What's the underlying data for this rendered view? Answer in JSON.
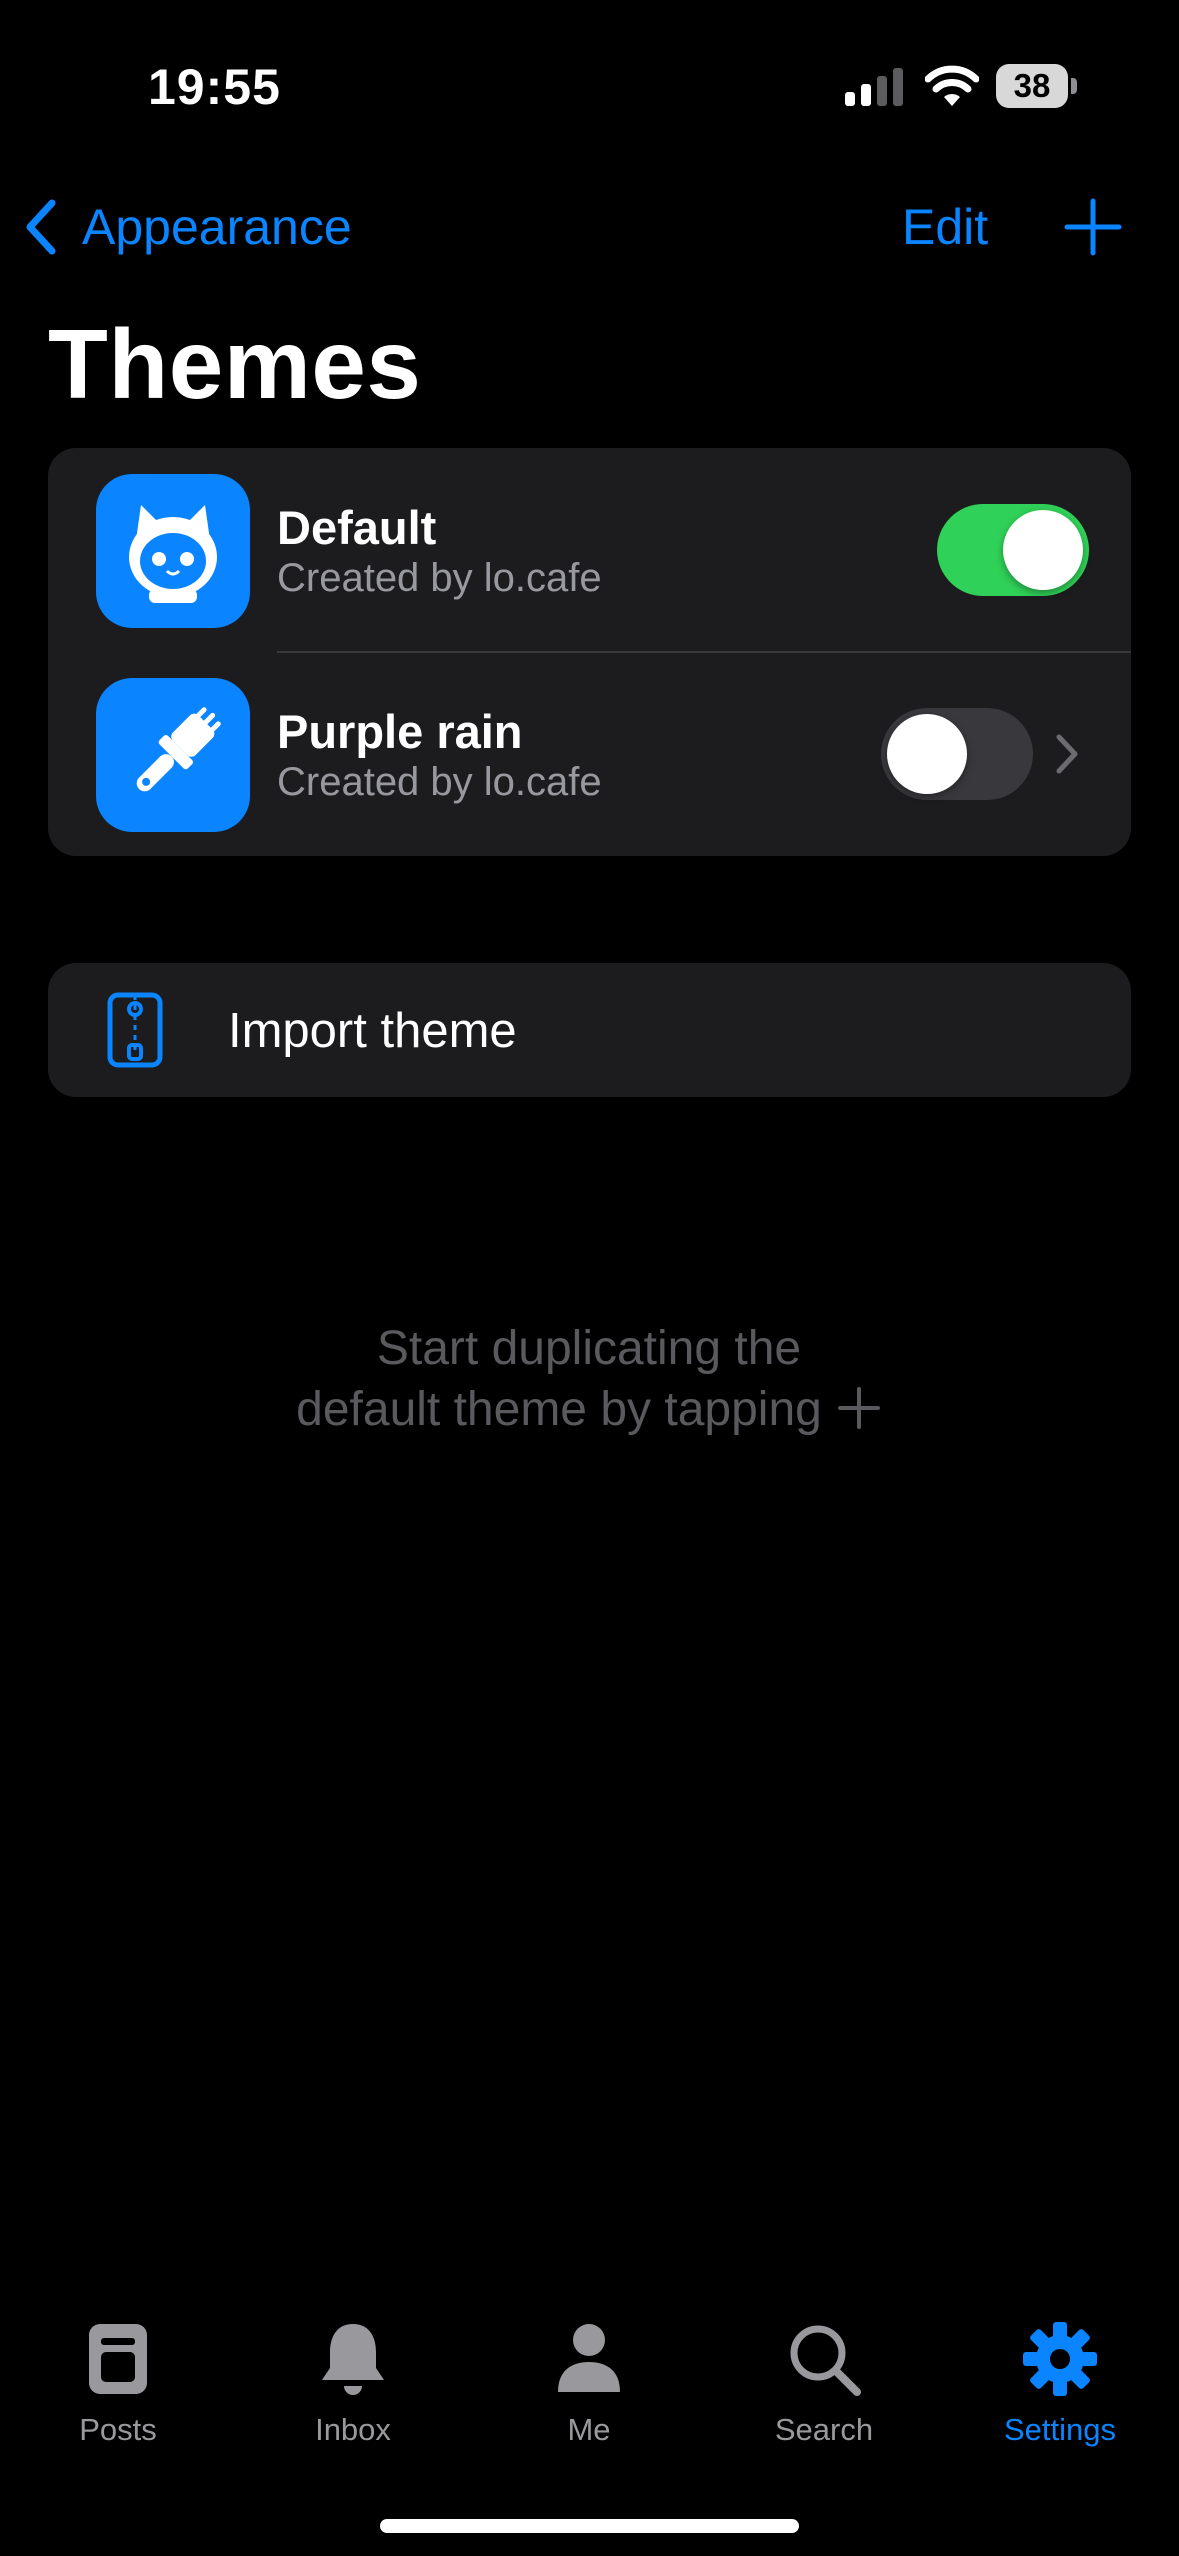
{
  "status_bar": {
    "time": "19:55",
    "battery": "38"
  },
  "nav": {
    "back_label": "Appearance",
    "edit_label": "Edit",
    "add_icon": "plus-icon"
  },
  "page": {
    "title": "Themes"
  },
  "themes": [
    {
      "name": "Default",
      "creator": "Created by lo.cafe",
      "enabled": true,
      "icon": "cat-astronaut-icon"
    },
    {
      "name": "Purple rain",
      "creator": "Created by lo.cafe",
      "enabled": false,
      "icon": "paintbrush-icon"
    }
  ],
  "import": {
    "label": "Import theme",
    "icon": "zip-file-icon"
  },
  "hint": {
    "line1": "Start duplicating the",
    "line2": "default theme by tapping"
  },
  "tabbar": {
    "items": [
      {
        "label": "Posts",
        "icon": "posts-icon"
      },
      {
        "label": "Inbox",
        "icon": "bell-icon"
      },
      {
        "label": "Me",
        "icon": "person-icon"
      },
      {
        "label": "Search",
        "icon": "search-icon"
      },
      {
        "label": "Settings",
        "icon": "gear-icon",
        "active": true
      }
    ]
  },
  "colors": {
    "accent": "#0a84ff",
    "toggle_on": "#30d158",
    "card": "#1c1c1e",
    "background": "#000000"
  }
}
